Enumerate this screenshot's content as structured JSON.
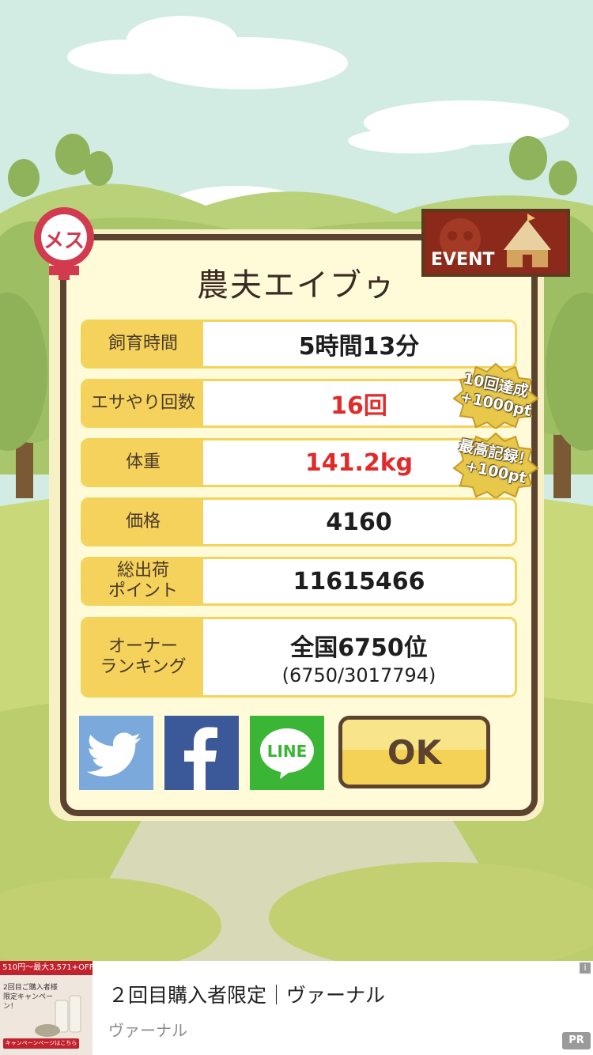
{
  "pet": {
    "name": "農夫エイブゥ",
    "gender_label": "メス"
  },
  "event_label": "EVENT",
  "stats": [
    {
      "label": "飼育時間",
      "value": "5時間13分",
      "highlight": false
    },
    {
      "label": "エサやり回数",
      "value": "16回",
      "highlight": true
    },
    {
      "label": "体重",
      "value": "141.2kg",
      "highlight": true
    },
    {
      "label": "価格",
      "value": "4160",
      "highlight": false
    },
    {
      "label": "総出荷\nポイント",
      "value": "11615466",
      "highlight": false
    },
    {
      "label": "オーナー\nランキング",
      "value": "全国6750位",
      "sub": "(6750/3017794)",
      "highlight": false
    }
  ],
  "badges": [
    {
      "line1": "10回達成",
      "line2": "+1000pt"
    },
    {
      "line1": "最高記録！",
      "line2": "+100pt"
    }
  ],
  "share": {
    "twitter_icon": "twitter-icon",
    "facebook_icon": "facebook-icon",
    "line_label": "LINE"
  },
  "ok_label": "OK",
  "colors": {
    "accent_yellow": "#f4d25c",
    "border_brown": "#5c4330",
    "highlight_red": "#e02b2b",
    "twitter": "#7ba9dc",
    "facebook": "#3b5998",
    "line": "#3bb536"
  },
  "ad": {
    "image_banner": "510円〜最大3,571+OFF",
    "image_text": "2回目ご購入者様 限定キャンペーン！",
    "image_button": "キャンペーンページはこちら",
    "title": "２回目購入者限定｜ヴァーナル",
    "sponsor": "ヴァーナル",
    "info": "i",
    "pr": "PR"
  }
}
